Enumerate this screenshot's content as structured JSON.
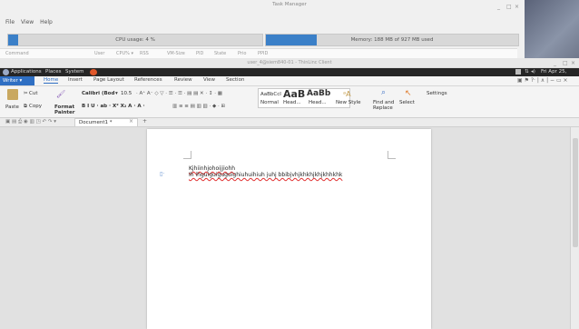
{
  "task_manager": {
    "title": "Task Manager",
    "window_controls": [
      "_",
      "□",
      "×"
    ],
    "menu": [
      "File",
      "View",
      "Help"
    ],
    "cpu_label": "CPU usage: 4 %",
    "cpu_fraction": 0.04,
    "memory_label": "Memory: 188 MB of 927 MB used",
    "memory_fraction": 0.2,
    "columns": [
      "Command",
      "User",
      "CPU% ▾",
      "RSS",
      "VM-Size",
      "PID",
      "State",
      "Prio",
      "PPID"
    ]
  },
  "remote_window": {
    "title": "user_4@siem840-01 - ThinLinc Client",
    "controls": [
      "_",
      "□",
      "×"
    ]
  },
  "desktop_bar": {
    "applications": "Applications",
    "places": "Places",
    "system": "System",
    "clock": "Fri Apr 25, 19:52"
  },
  "wps": {
    "app_button": "Writer",
    "tabs": [
      "Home",
      "Insert",
      "Page Layout",
      "References",
      "Review",
      "View",
      "Section"
    ],
    "clipboard": {
      "cut": "Cut",
      "paste": "Paste",
      "copy": "Copy",
      "format_painter_1": "Format",
      "format_painter_2": "Painter"
    },
    "font_name": "Calibri (Bod",
    "font_size": "10.5",
    "font_buttons": "B  I  U  ·  ab  ·  X²  X₂  A  ·  A  ·",
    "styles": [
      {
        "preview": "AaBbCcI",
        "name": "Normal"
      },
      {
        "preview": "AaB",
        "name": "Head..."
      },
      {
        "preview": "AaBb",
        "name": "Head..."
      }
    ],
    "new_style": "New Style",
    "find_1": "Find and",
    "find_2": "Replace",
    "select": "Select",
    "settings": "Settings",
    "doc_tab": "Document1 *",
    "plus": "+"
  },
  "document": {
    "line1": "Kjhiinhjohoijjiohh",
    "line2": "Ih ihguiguiguguighiuhuihiuh juhj bbibjvhjkhkhjkhjkhhkhk"
  }
}
